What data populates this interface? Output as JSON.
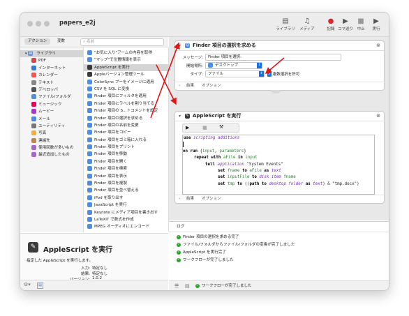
{
  "window": {
    "title": "papers_e2j"
  },
  "toolbar": {
    "buttons": [
      {
        "label": "ライブラリ",
        "icon": "library-icon"
      },
      {
        "label": "メディア",
        "icon": "media-icon"
      },
      {
        "label": "記録",
        "icon": "record-icon"
      },
      {
        "label": "コマ送り",
        "icon": "step-icon"
      },
      {
        "label": "中止",
        "icon": "stop-icon"
      },
      {
        "label": "実行",
        "icon": "run-icon"
      }
    ]
  },
  "tabs": {
    "actions": "アクション",
    "variables": "変数",
    "search_placeholder": "名前"
  },
  "library": {
    "header": "ライブラリ",
    "items": [
      "PDF",
      "インターネット",
      "カレンダー",
      "テキスト",
      "デベロッパ",
      "ファイル/フォルダ",
      "ミュージック",
      "ムービー",
      "メール",
      "ユーティリティ",
      "写真",
      "連絡先",
      "使用回数が多いもの",
      "最近追加したもの"
    ]
  },
  "actions_list": [
    "\"お気に入り\"アームの内容を取得",
    "\"マップ\"で位置情報を表示",
    "AppleScript を実行",
    "Appleバージョン管理ツール",
    "ColorSync プーをイメージに適用",
    "CSV を SQL に変換",
    "Finder 項目にフィルタを適用",
    "Finder 項目にラベルを割り当てる",
    "Finder 項目の S...トコメントを設定",
    "Finder 項目の選択を求める",
    "Finder 項目の名前を変更",
    "Finder 項目をコピー",
    "Finder 項目をゴミ箱に入れる",
    "Finder 項目をプリント",
    "Finder 項目を移動",
    "Finder 項目を開く",
    "Finder 項目を検索",
    "Finder 項目を表示",
    "Finder 項目を複製",
    "Finder 項目を並べ替える",
    "iPod を取り出す",
    "JavaScript を実行",
    "Keynote にメディア項目を書き出す",
    "LaTeXIT で数式を作成",
    "MPEG オーディオにエンコード"
  ],
  "description": {
    "title": "AppleScript を実行",
    "text": "指定した AppleScript を実行します。",
    "input_label": "入力:",
    "input_value": "特定なし",
    "result_label": "結果:",
    "result_value": "特定なし",
    "version_label": "バージョン:",
    "version_value": "1.0.2"
  },
  "card1": {
    "title": "Finder 項目の選択を求める",
    "prompt_label": "メッセージ:",
    "prompt_value": "Finder 項目を選択:",
    "start_label": "開始場所:",
    "start_value": "デスクトップ",
    "type_label": "タイプ:",
    "type_value": "ファイル",
    "multi_label": "複数選択を許可",
    "foot_results": "結果",
    "foot_options": "オプション"
  },
  "card2": {
    "title": "AppleScript を実行",
    "code": [
      "use scripting additions",
      "",
      "on run {input, parameters}",
      "    repeat with aFile in input",
      "        tell application \"System Events\"",
      "            set fname to aFile as text",
      "            set inputFile to disk item fname",
      "            set tmp to ((path to desktop folder as text) & \"tmp.docx\")"
    ],
    "foot_results": "結果",
    "foot_options": "オプション"
  },
  "log": {
    "header": "ログ",
    "entries": [
      "Finder 項目の選択を求める完了",
      "ファイル/フォルダからファイル/フォルダの変換が完了しました",
      "AppleScript を実行完了",
      "ワークフローが完了しました"
    ]
  },
  "status": {
    "text": "ワークフローが完了しました"
  },
  "colors": {
    "accent": "#1a6fe0",
    "arrow": "#e01515",
    "success": "#2aa52a",
    "record": "#e0262a"
  }
}
